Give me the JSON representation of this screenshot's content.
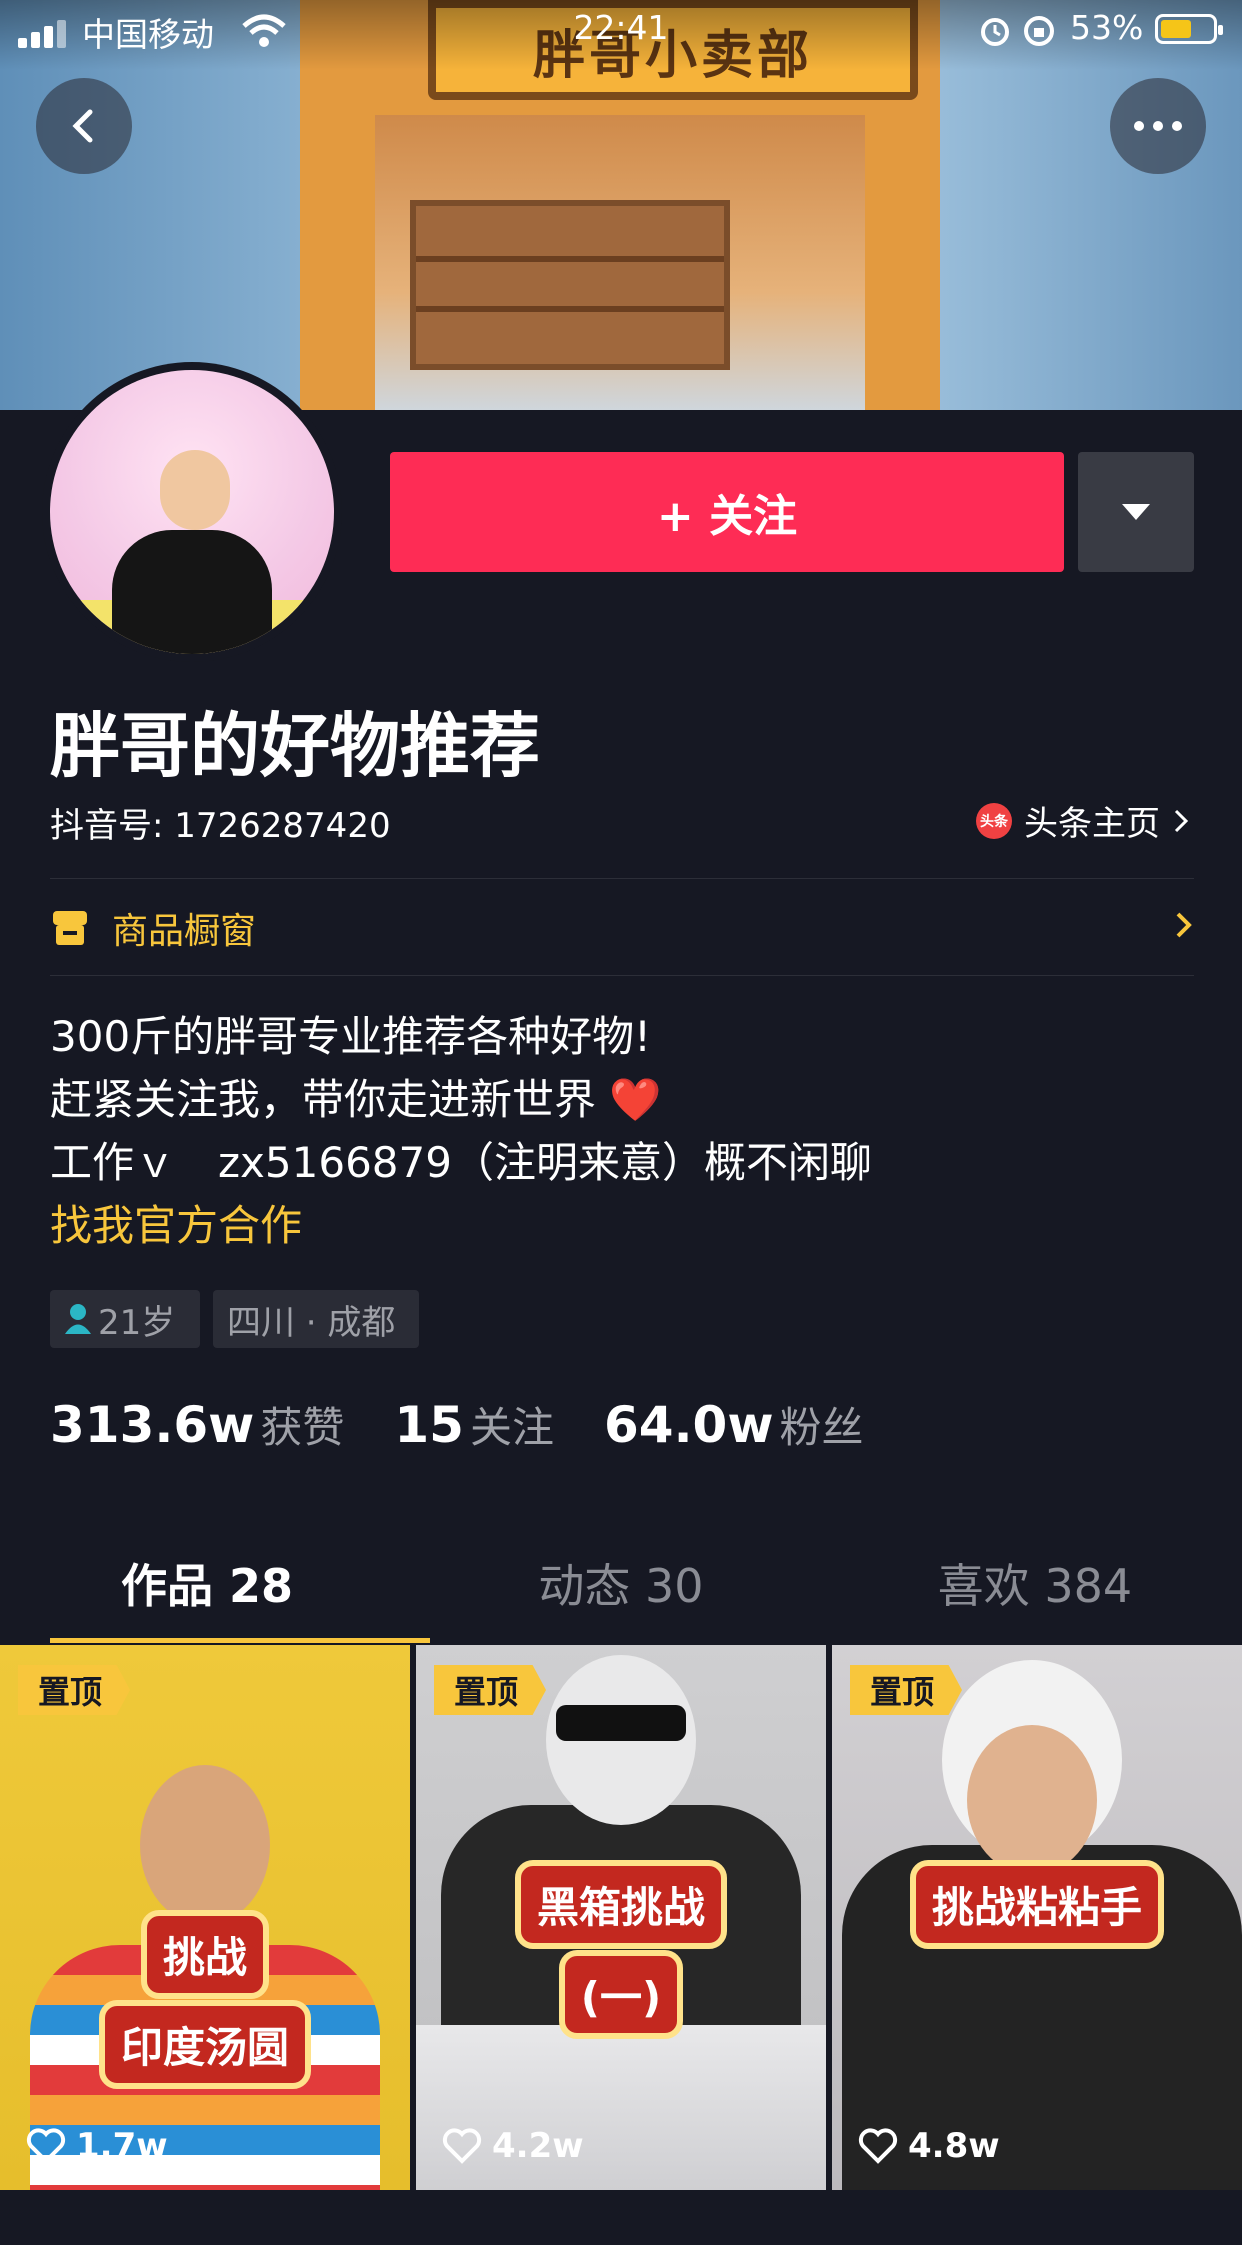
{
  "status_bar": {
    "carrier": "中国移动",
    "time": "22:41",
    "battery_percent": "53%"
  },
  "banner": {
    "store_sign": "胖哥小卖部"
  },
  "actions": {
    "follow_label": "+ 关注"
  },
  "profile": {
    "name": "胖哥的好物推荐",
    "douyin_id": "抖音号: 1726287420",
    "toutiao_icon": "头条",
    "toutiao_link": "头条主页",
    "shop_window": "商品橱窗",
    "bio_line1": "300斤的胖哥专业推荐各种好物!",
    "bio_line2": "赶紧关注我，带你走进新世界",
    "bio_emoji": "❤️",
    "bio_line3": "工作ｖ　zx5166879（注明来意）概不闲聊",
    "collab_link": "找我官方合作",
    "tags": {
      "age": "21岁",
      "location": "四川 · 成都"
    }
  },
  "stats": [
    {
      "value": "313.6w",
      "label": "获赞"
    },
    {
      "value": "15",
      "label": "关注"
    },
    {
      "value": "64.0w",
      "label": "粉丝"
    }
  ],
  "tabs": [
    {
      "label": "作品 28"
    },
    {
      "label": "动态 30"
    },
    {
      "label": "喜欢 384"
    }
  ],
  "videos": [
    {
      "pin": "置顶",
      "caption1": "挑战",
      "caption2": "印度汤圆",
      "likes": "1.7w"
    },
    {
      "pin": "置顶",
      "caption1": "黑箱挑战",
      "caption2": "(一)",
      "likes": "4.2w"
    },
    {
      "pin": "置顶",
      "caption1": "挑战粘粘手",
      "likes": "4.8w"
    }
  ],
  "colors": {
    "background": "#161823",
    "follow": "#fe2c55",
    "accent_yellow": "#f8c63c"
  }
}
